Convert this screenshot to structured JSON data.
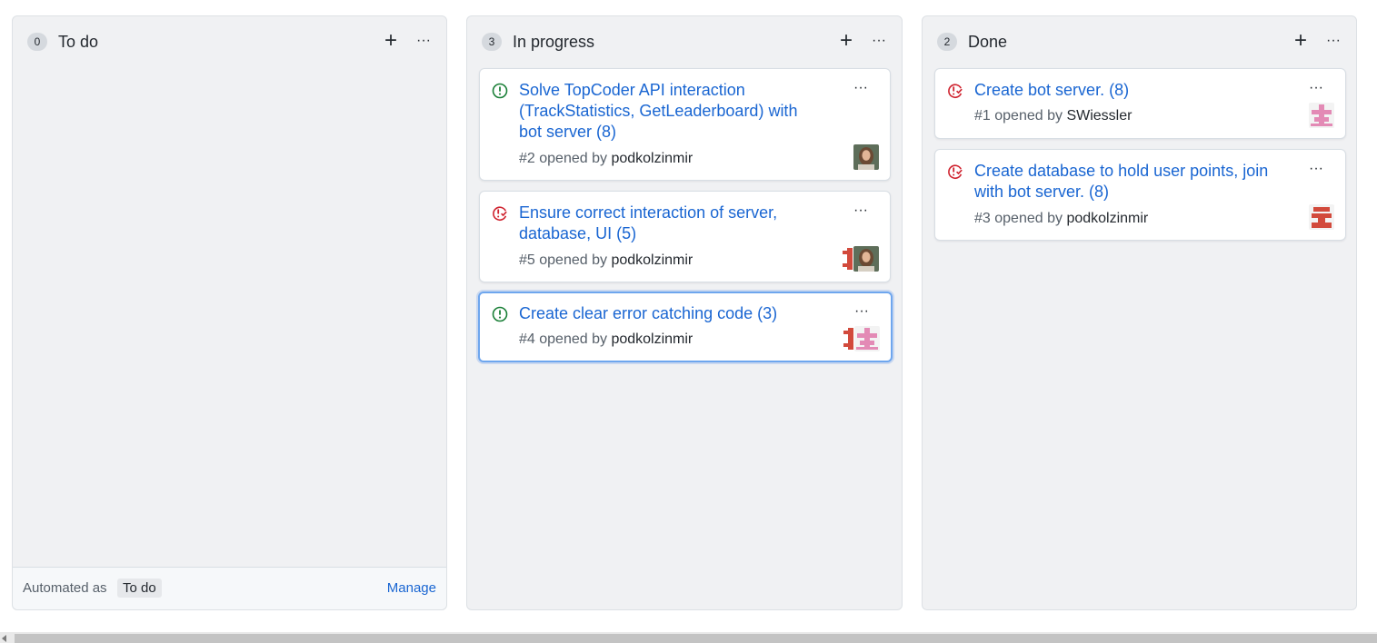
{
  "columns": [
    {
      "count": "0",
      "title": "To do",
      "add_label": "+",
      "more_label": "···",
      "footer": {
        "automated_label": "Automated as",
        "automated_value": "To do",
        "manage_label": "Manage"
      },
      "cards": []
    },
    {
      "count": "3",
      "title": "In progress",
      "add_label": "+",
      "more_label": "···",
      "cards": [
        {
          "status": "open",
          "title": "Solve TopCoder API interaction (TrackStatistics, GetLeaderboard) with bot server (8)",
          "number": "#2",
          "opened_by": "opened by",
          "author": "podkolzinmir",
          "more_label": "···",
          "avatars": [
            "photo-avatar"
          ]
        },
        {
          "status": "closed",
          "title": "Ensure correct interaction of server, database, UI (5)",
          "number": "#5",
          "opened_by": "opened by",
          "author": "podkolzinmir",
          "more_label": "···",
          "avatars": [
            "red-identicon-avatar",
            "photo-avatar"
          ]
        },
        {
          "status": "open",
          "title": "Create clear error catching code (3)",
          "number": "#4",
          "opened_by": "opened by",
          "author": "podkolzinmir",
          "more_label": "···",
          "avatars": [
            "red-identicon-avatar",
            "pink-identicon-avatar"
          ]
        }
      ]
    },
    {
      "count": "2",
      "title": "Done",
      "add_label": "+",
      "more_label": "···",
      "cards": [
        {
          "status": "closed",
          "title": "Create bot server. (8)",
          "number": "#1",
          "opened_by": "opened by",
          "author": "SWiessler",
          "more_label": "···",
          "avatars": [
            "pink-identicon-avatar"
          ]
        },
        {
          "status": "closed",
          "title": "Create database to hold user points, join with bot server. (8)",
          "number": "#3",
          "opened_by": "opened by",
          "author": "podkolzinmir",
          "more_label": "···",
          "avatars": [
            "red-identicon-avatar"
          ]
        }
      ]
    }
  ],
  "colors": {
    "link": "#1a66d2",
    "open_status": "#1a7f37",
    "closed_status": "#cf222e",
    "column_bg": "#f0f1f3"
  }
}
